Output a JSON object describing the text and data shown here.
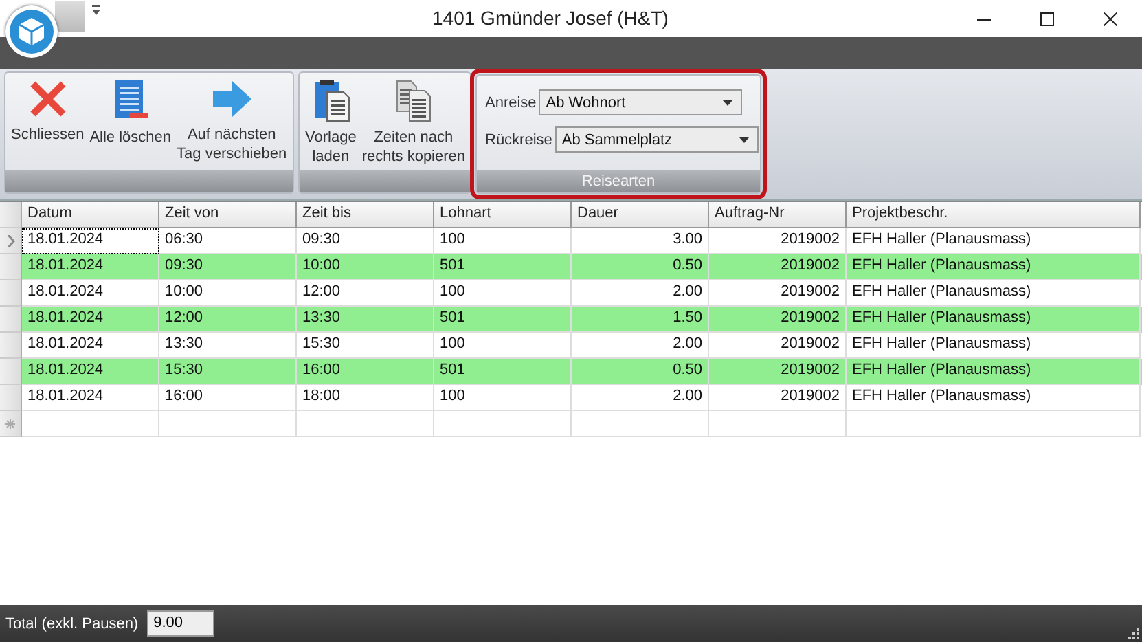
{
  "window": {
    "title": "1401 Gmünder Josef (H&T)"
  },
  "ribbon": {
    "groups": [
      {
        "kind": "buttons",
        "highlighted": false,
        "buttons": [
          {
            "label": "Schliessen"
          },
          {
            "label": "Alle löschen"
          },
          {
            "label": "Auf nächsten\nTag verschieben"
          }
        ]
      },
      {
        "kind": "buttons",
        "highlighted": false,
        "buttons": [
          {
            "label": "Vorlage\nladen"
          },
          {
            "label": "Zeiten nach\nrechts kopieren"
          }
        ]
      },
      {
        "kind": "fields",
        "caption": "Reisearten",
        "highlighted": true,
        "fields": [
          {
            "label": "Anreise",
            "value": "Ab Wohnort"
          },
          {
            "label": "Rückreise",
            "value": "Ab Sammelplatz"
          }
        ]
      }
    ]
  },
  "table": {
    "columns": [
      {
        "label": "Datum",
        "kind": "text"
      },
      {
        "label": "Zeit von",
        "kind": "text"
      },
      {
        "label": "Zeit bis",
        "kind": "text"
      },
      {
        "label": "Lohnart",
        "kind": "text"
      },
      {
        "label": "Dauer",
        "kind": "number"
      },
      {
        "label": "Auftrag-Nr",
        "kind": "number"
      },
      {
        "label": "Projektbeschr.",
        "kind": "text"
      }
    ],
    "rows": [
      {
        "current": true,
        "highlighted": false,
        "cells": [
          "18.01.2024",
          "06:30",
          "09:30",
          "100",
          "3.00",
          "2019002",
          "EFH Haller (Planausmass)"
        ]
      },
      {
        "current": false,
        "highlighted": true,
        "cells": [
          "18.01.2024",
          "09:30",
          "10:00",
          "501",
          "0.50",
          "2019002",
          "EFH Haller (Planausmass)"
        ]
      },
      {
        "current": false,
        "highlighted": false,
        "cells": [
          "18.01.2024",
          "10:00",
          "12:00",
          "100",
          "2.00",
          "2019002",
          "EFH Haller (Planausmass)"
        ]
      },
      {
        "current": false,
        "highlighted": true,
        "cells": [
          "18.01.2024",
          "12:00",
          "13:30",
          "501",
          "1.50",
          "2019002",
          "EFH Haller (Planausmass)"
        ]
      },
      {
        "current": false,
        "highlighted": false,
        "cells": [
          "18.01.2024",
          "13:30",
          "15:30",
          "100",
          "2.00",
          "2019002",
          "EFH Haller (Planausmass)"
        ]
      },
      {
        "current": false,
        "highlighted": true,
        "cells": [
          "18.01.2024",
          "15:30",
          "16:00",
          "501",
          "0.50",
          "2019002",
          "EFH Haller (Planausmass)"
        ]
      },
      {
        "current": false,
        "highlighted": false,
        "cells": [
          "18.01.2024",
          "16:00",
          "18:00",
          "100",
          "2.00",
          "2019002",
          "EFH Haller (Planausmass)"
        ]
      }
    ]
  },
  "footer": {
    "label": "Total (exkl. Pausen)",
    "value": "9.00"
  }
}
